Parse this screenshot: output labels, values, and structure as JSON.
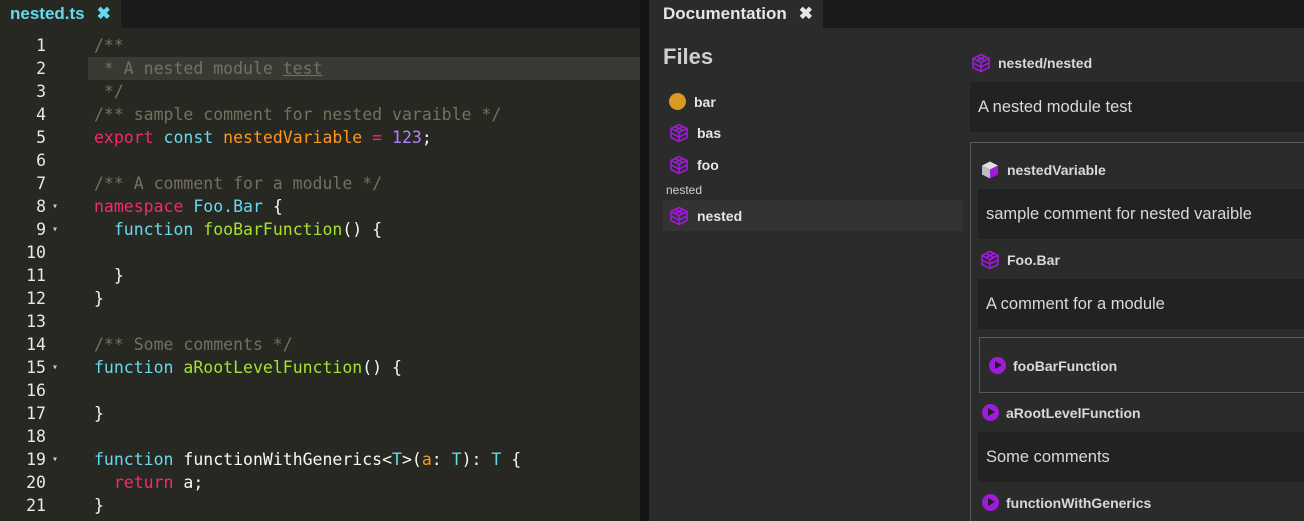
{
  "editor": {
    "tab_label": "nested.ts",
    "tab_close": "✖",
    "lines": [
      {
        "n": "1",
        "fold": "",
        "tokens": [
          {
            "c": "t-comment",
            "t": "/**"
          }
        ]
      },
      {
        "n": "2",
        "fold": "",
        "active": true,
        "tokens": [
          {
            "c": "t-comment",
            "t": " * A nested module "
          },
          {
            "c": "t-comment t-underline",
            "t": "test"
          }
        ]
      },
      {
        "n": "3",
        "fold": "",
        "tokens": [
          {
            "c": "t-comment",
            "t": " */"
          }
        ]
      },
      {
        "n": "4",
        "fold": "",
        "tokens": [
          {
            "c": "t-comment",
            "t": "/** sample comment for nested varaible */"
          }
        ]
      },
      {
        "n": "5",
        "fold": "",
        "tokens": [
          {
            "c": "t-kw",
            "t": "export"
          },
          {
            "c": "t-plain",
            "t": " "
          },
          {
            "c": "t-store",
            "t": "const"
          },
          {
            "c": "t-plain",
            "t": " "
          },
          {
            "c": "t-var",
            "t": "nestedVariable"
          },
          {
            "c": "t-plain",
            "t": " "
          },
          {
            "c": "t-kw",
            "t": "="
          },
          {
            "c": "t-plain",
            "t": " "
          },
          {
            "c": "t-num",
            "t": "123"
          },
          {
            "c": "t-plain",
            "t": ";"
          }
        ]
      },
      {
        "n": "6",
        "fold": "",
        "tokens": []
      },
      {
        "n": "7",
        "fold": "",
        "tokens": [
          {
            "c": "t-comment",
            "t": "/** A comment for a module */"
          }
        ]
      },
      {
        "n": "8",
        "fold": "▾",
        "tokens": [
          {
            "c": "t-kw",
            "t": "namespace"
          },
          {
            "c": "t-plain",
            "t": " "
          },
          {
            "c": "t-type",
            "t": "Foo.Bar"
          },
          {
            "c": "t-plain",
            "t": " {"
          }
        ]
      },
      {
        "n": "9",
        "fold": "▾",
        "tokens": [
          {
            "c": "t-plain",
            "t": "  "
          },
          {
            "c": "t-store",
            "t": "function"
          },
          {
            "c": "t-plain",
            "t": " "
          },
          {
            "c": "t-fn",
            "t": "fooBarFunction"
          },
          {
            "c": "t-plain",
            "t": "() {"
          }
        ]
      },
      {
        "n": "10",
        "fold": "",
        "tokens": []
      },
      {
        "n": "11",
        "fold": "",
        "tokens": [
          {
            "c": "t-plain",
            "t": "  }"
          }
        ]
      },
      {
        "n": "12",
        "fold": "",
        "tokens": [
          {
            "c": "t-plain",
            "t": "}"
          }
        ]
      },
      {
        "n": "13",
        "fold": "",
        "tokens": []
      },
      {
        "n": "14",
        "fold": "",
        "tokens": [
          {
            "c": "t-comment",
            "t": "/** Some comments */"
          }
        ]
      },
      {
        "n": "15",
        "fold": "▾",
        "tokens": [
          {
            "c": "t-store",
            "t": "function"
          },
          {
            "c": "t-plain",
            "t": " "
          },
          {
            "c": "t-fn",
            "t": "aRootLevelFunction"
          },
          {
            "c": "t-plain",
            "t": "() {"
          }
        ]
      },
      {
        "n": "16",
        "fold": "",
        "tokens": []
      },
      {
        "n": "17",
        "fold": "",
        "tokens": [
          {
            "c": "t-plain",
            "t": "}"
          }
        ]
      },
      {
        "n": "18",
        "fold": "",
        "tokens": []
      },
      {
        "n": "19",
        "fold": "▾",
        "tokens": [
          {
            "c": "t-store",
            "t": "function"
          },
          {
            "c": "t-plain",
            "t": " functionWithGenerics<"
          },
          {
            "c": "t-type",
            "t": "T"
          },
          {
            "c": "t-plain",
            "t": ">("
          },
          {
            "c": "t-param",
            "t": "a"
          },
          {
            "c": "t-plain",
            "t": ": "
          },
          {
            "c": "t-type",
            "t": "T"
          },
          {
            "c": "t-plain",
            "t": "): "
          },
          {
            "c": "t-type",
            "t": "T"
          },
          {
            "c": "t-plain",
            "t": " {"
          }
        ]
      },
      {
        "n": "20",
        "fold": "",
        "tokens": [
          {
            "c": "t-plain",
            "t": "  "
          },
          {
            "c": "t-kw",
            "t": "return"
          },
          {
            "c": "t-plain",
            "t": " a;"
          }
        ]
      },
      {
        "n": "21",
        "fold": "",
        "tokens": [
          {
            "c": "t-plain",
            "t": "}"
          }
        ]
      }
    ]
  },
  "docs": {
    "tab_label": "Documentation",
    "tab_close": "✖",
    "files_title": "Files",
    "files": [
      {
        "label": "bar",
        "icon": "dot-icon"
      },
      {
        "label": "bas",
        "icon": "cube-icon"
      },
      {
        "label": "foo",
        "icon": "cube-icon"
      }
    ],
    "group_label": "nested",
    "selected_file": {
      "label": "nested",
      "icon": "cube-icon"
    },
    "module_title": "nested/nested",
    "module_desc": "A nested module test",
    "items": {
      "var_name": "nestedVariable",
      "var_desc": "sample comment for nested varaible",
      "ns_name": "Foo.Bar",
      "ns_desc": "A comment for a module",
      "fn1_name": "fooBarFunction",
      "fn2_name": "aRootLevelFunction",
      "fn2_desc": "Some comments",
      "fn3_name": "functionWithGenerics"
    },
    "colors": {
      "accent_purple": "#9d1bd9",
      "dot_orange": "#d99a1f"
    }
  }
}
